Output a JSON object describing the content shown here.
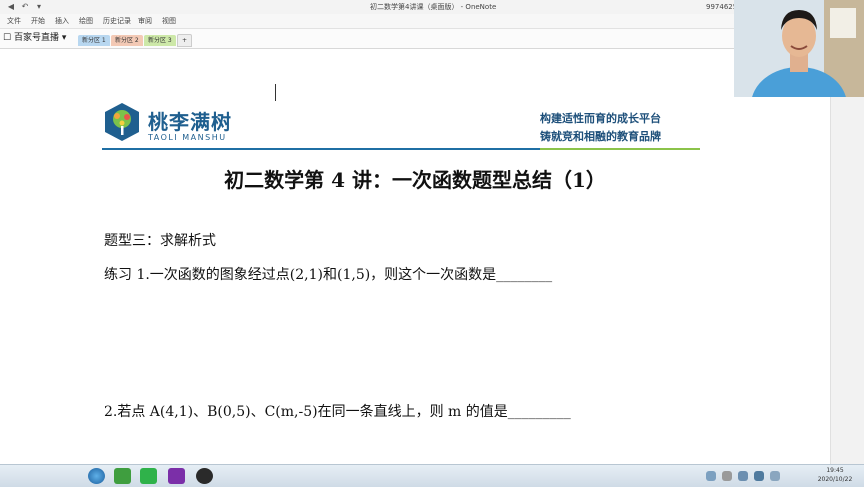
{
  "window": {
    "title": "初二数学第4讲课（桌面版） - OneNote",
    "user_id": "9974625153"
  },
  "ribbon": {
    "tabs": [
      "文件",
      "开始",
      "插入",
      "绘图",
      "历史记录",
      "审阅",
      "视图"
    ]
  },
  "notebook": {
    "name": "百家号直播",
    "sections": [
      {
        "label": "新分区 1",
        "color": "#b8d7f0"
      },
      {
        "label": "新分区 2",
        "color": "#f3c9b5"
      },
      {
        "label": "新分区 3",
        "color": "#cde8a8"
      }
    ],
    "add_label": "+"
  },
  "document": {
    "logo_cn": "桃李满树",
    "logo_en": "TAOLI MANSHU",
    "slogan_line1": "构建适性而育的成长平台",
    "slogan_line2": "铸就竞和相融的教育品牌",
    "title": "初二数学第 4 讲：一次函数题型总结（1）",
    "heading": "题型三：求解析式",
    "q1": "练习 1.一次函数的图象经过点(2,1)和(1,5)，则这个一次函数是________",
    "q2": "2.若点 A(4,1)、B(0,5)、C(m,-5)在同一条直线上，则 m 的值是_________"
  },
  "taskbar": {
    "time": "19:45",
    "date": "2020/10/22"
  },
  "colors": {
    "brand_blue": "#1f5f8f",
    "accent_green": "#8bc34a",
    "onenote_purple": "#7b2fa8"
  }
}
